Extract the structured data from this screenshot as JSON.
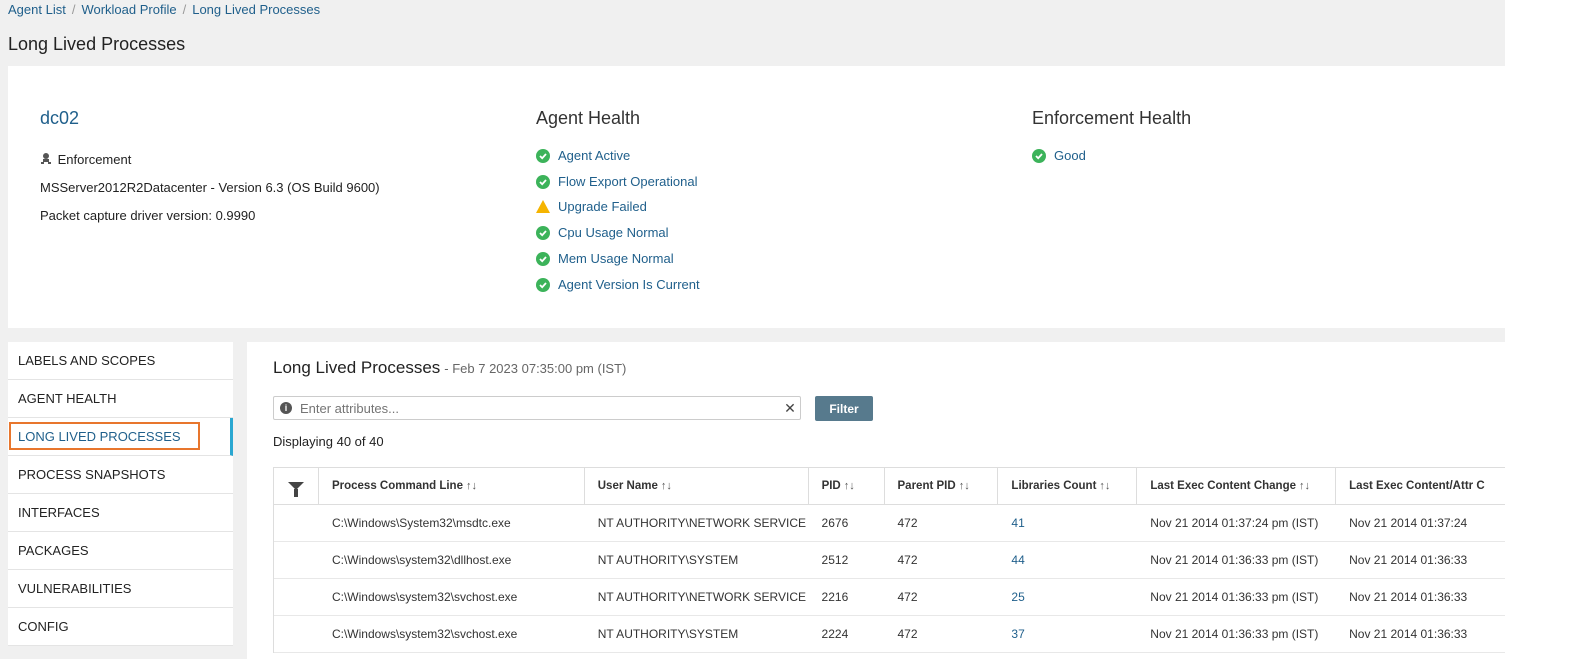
{
  "breadcrumb": [
    "Agent List",
    "Workload Profile",
    "Long Lived Processes"
  ],
  "page_title": "Long Lived Processes",
  "summary": {
    "host": "dc02",
    "enforcement_label": "Enforcement",
    "os_line": "MSServer2012R2Datacenter - Version 6.3 (OS Build 9600)",
    "driver_line": "Packet capture driver version: 0.9990",
    "agent_health": {
      "title": "Agent Health",
      "items": [
        {
          "label": "Agent Active",
          "status": "ok"
        },
        {
          "label": "Flow Export Operational",
          "status": "ok"
        },
        {
          "label": "Upgrade Failed",
          "status": "warning"
        },
        {
          "label": "Cpu Usage Normal",
          "status": "ok"
        },
        {
          "label": "Mem Usage Normal",
          "status": "ok"
        },
        {
          "label": "Agent Version Is Current",
          "status": "ok"
        }
      ]
    },
    "enforcement_health": {
      "title": "Enforcement Health",
      "items": [
        {
          "label": "Good",
          "status": "ok"
        }
      ]
    }
  },
  "side_nav": [
    {
      "label": "LABELS AND SCOPES",
      "active": false
    },
    {
      "label": "AGENT HEALTH",
      "active": false
    },
    {
      "label": "LONG LIVED PROCESSES",
      "active": true
    },
    {
      "label": "PROCESS SNAPSHOTS",
      "active": false
    },
    {
      "label": "INTERFACES",
      "active": false
    },
    {
      "label": "PACKAGES",
      "active": false
    },
    {
      "label": "VULNERABILITIES",
      "active": false
    },
    {
      "label": "CONFIG",
      "active": false
    }
  ],
  "main": {
    "title": "Long Lived Processes",
    "subtitle": "- Feb 7 2023 07:35:00 pm (IST)",
    "search_placeholder": "Enter attributes...",
    "filter_label": "Filter",
    "displaying": "Displaying 40 of 40",
    "columns": [
      "Process Command Line",
      "User Name",
      "PID",
      "Parent PID",
      "Libraries Count",
      "Last Exec Content Change",
      "Last Exec Content/Attr C"
    ],
    "sort_glyph": "↑↓",
    "rows": [
      [
        "C:\\Windows\\System32\\msdtc.exe",
        "NT AUTHORITY\\NETWORK SERVICE",
        "2676",
        "472",
        "41",
        "Nov 21 2014 01:37:24 pm (IST)",
        "Nov 21 2014 01:37:24"
      ],
      [
        "C:\\Windows\\system32\\dllhost.exe",
        "NT AUTHORITY\\SYSTEM",
        "2512",
        "472",
        "44",
        "Nov 21 2014 01:36:33 pm (IST)",
        "Nov 21 2014 01:36:33"
      ],
      [
        "C:\\Windows\\system32\\svchost.exe",
        "NT AUTHORITY\\NETWORK SERVICE",
        "2216",
        "472",
        "25",
        "Nov 21 2014 01:36:33 pm (IST)",
        "Nov 21 2014 01:36:33"
      ],
      [
        "C:\\Windows\\system32\\svchost.exe",
        "NT AUTHORITY\\SYSTEM",
        "2224",
        "472",
        "37",
        "Nov 21 2014 01:36:33 pm (IST)",
        "Nov 21 2014 01:36:33"
      ]
    ]
  },
  "colors": {
    "link": "#1f5f8b",
    "ok": "#3cb35a",
    "warning": "#f5b400",
    "active_border": "#2aa7d1",
    "highlight": "#e8762d",
    "filter_button": "#577a8d"
  }
}
